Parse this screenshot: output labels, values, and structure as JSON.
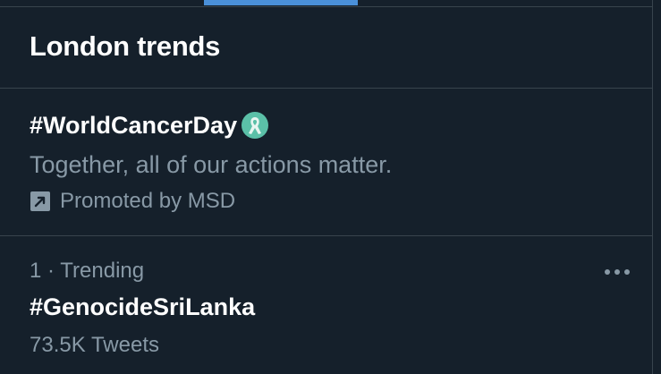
{
  "header": {
    "title": "London trends"
  },
  "promoted_trend": {
    "hashtag": "#WorldCancerDay",
    "hashtag_icon": "ribbon-icon",
    "description": "Together, all of our actions matter.",
    "promoted_icon": "promoted-arrow-icon",
    "promoted_by": "Promoted by MSD"
  },
  "trends": [
    {
      "rank": "1",
      "separator": "·",
      "category": "Trending",
      "name": "#GenocideSriLanka",
      "tweet_count": "73.5K Tweets",
      "more_icon": "more-icon"
    }
  ],
  "colors": {
    "background": "#15202b",
    "border": "#38444d",
    "primary_text": "#ffffff",
    "secondary_text": "#8899a6",
    "accent": "#4a90d9",
    "ribbon": "#5bc0a8"
  }
}
